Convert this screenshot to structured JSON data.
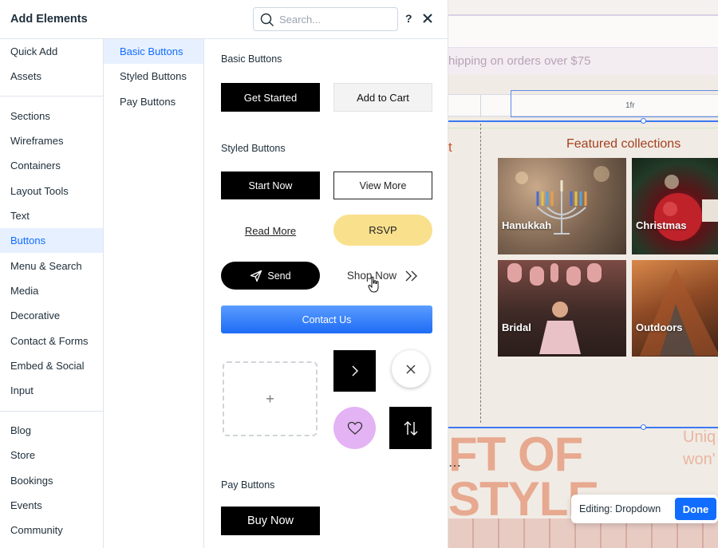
{
  "panel": {
    "title": "Add Elements",
    "search_placeholder": "Search...",
    "help_label": "?"
  },
  "categories": {
    "group1": [
      "Quick Add",
      "Assets"
    ],
    "group2": [
      "Sections",
      "Wireframes",
      "Containers",
      "Layout Tools",
      "Text",
      "Buttons",
      "Menu & Search",
      "Media",
      "Decorative",
      "Contact & Forms",
      "Embed & Social",
      "Input"
    ],
    "group3": [
      "Blog",
      "Store",
      "Bookings",
      "Events",
      "Community"
    ],
    "active": "Buttons"
  },
  "subcategories": {
    "items": [
      "Basic Buttons",
      "Styled Buttons",
      "Pay Buttons"
    ],
    "active": "Basic Buttons"
  },
  "content": {
    "basic_title": "Basic Buttons",
    "basic": {
      "get_started": "Get Started",
      "add_to_cart": "Add to Cart"
    },
    "styled_title": "Styled Buttons",
    "styled": {
      "start_now": "Start Now",
      "view_more": "View More",
      "read_more": "Read More",
      "rsvp": "RSVP",
      "send": "Send",
      "shop_now": "Shop Now",
      "contact_us": "Contact Us",
      "plus": "+"
    },
    "pay_title": "Pay Buttons",
    "pay": {
      "buy_now": "Buy Now"
    }
  },
  "canvas": {
    "announcement": "hipping on orders over $75",
    "grid_label": "1fr",
    "partial_t": "t",
    "featured_title": "Featured collections",
    "tiles": [
      "Hanukkah",
      "Christmas",
      "Bridal",
      "Outdoors"
    ],
    "big_line1": "FT OF",
    "big_line2": "STYLE",
    "side_line1": "Uniq",
    "side_line2": "won'",
    "more_dots": "⋯",
    "editing_label": "Editing: Dropdown",
    "done_label": "Done"
  },
  "colors": {
    "accent": "#116dff",
    "active_bg": "#e7f0ff",
    "rsvp_yellow": "#f9e08c",
    "heart_purple": "#e3b3f4",
    "featured_text": "#a3411f",
    "big_text": "#e7a98f"
  }
}
